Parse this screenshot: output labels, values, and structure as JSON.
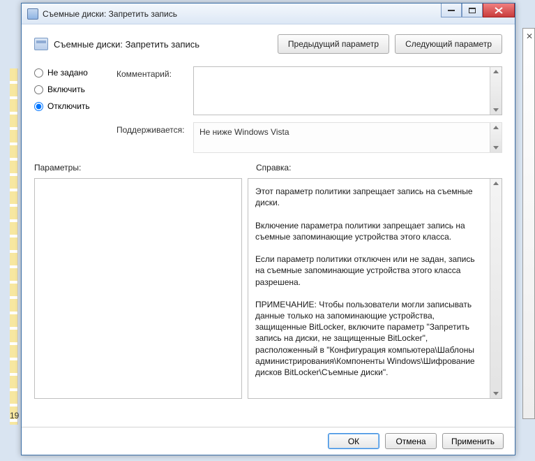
{
  "window": {
    "title": "Съемные диски: Запретить запись"
  },
  "header": {
    "title": "Съемные диски: Запретить запись",
    "prev": "Предыдущий параметр",
    "next": "Следующий параметр"
  },
  "radios": {
    "not_configured": "Не задано",
    "enabled": "Включить",
    "disabled": "Отключить",
    "selected": "disabled"
  },
  "fields": {
    "comment_label": "Комментарий:",
    "comment_value": "",
    "supported_label": "Поддерживается:",
    "supported_value": "Не ниже Windows Vista"
  },
  "panels": {
    "params_label": "Параметры:",
    "help_label": "Справка:",
    "help_text": "Этот параметр политики запрещает запись на съемные диски.\n\nВключение параметра политики запрещает запись на съемные запоминающие устройства этого класса.\n\nЕсли параметр политики отключен или не задан, запись на съемные запоминающие устройства этого класса разрешена.\n\nПРИМЕЧАНИЕ: Чтобы пользователи могли записывать данные только на запоминающие устройства, защищенные BitLocker, включите параметр \"Запретить запись на диски, не защищенные BitLocker\", расположенный в \"Конфигурация компьютера\\Шаблоны администрирования\\Компоненты Windows\\Шифрование дисков BitLocker\\Съемные диски\"."
  },
  "footer": {
    "ok": "ОК",
    "cancel": "Отмена",
    "apply": "Применить"
  },
  "background": {
    "status": "19"
  }
}
